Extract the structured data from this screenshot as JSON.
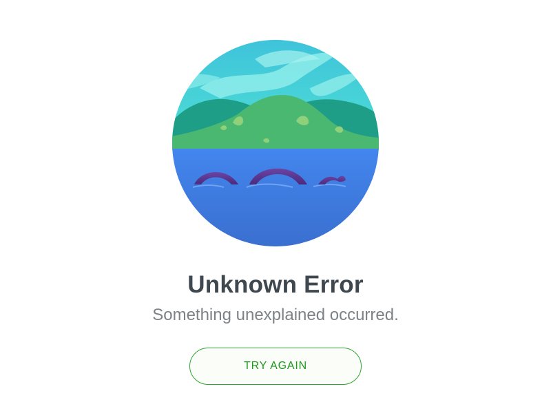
{
  "error": {
    "title": "Unknown Error",
    "message": "Something unexplained occurred."
  },
  "actions": {
    "retry_label": "TRY AGAIN"
  },
  "illustration": {
    "icon": "loch-ness-monster-illustration",
    "colors": {
      "sky": "#3fd3d6",
      "hills": "#45b56f",
      "water": "#3f7fe0",
      "monster": "#5a3a8f"
    }
  },
  "colors": {
    "title": "#3f474f",
    "subtitle": "#7d8287",
    "accent": "#2ea72e",
    "background": "#ffffff"
  }
}
